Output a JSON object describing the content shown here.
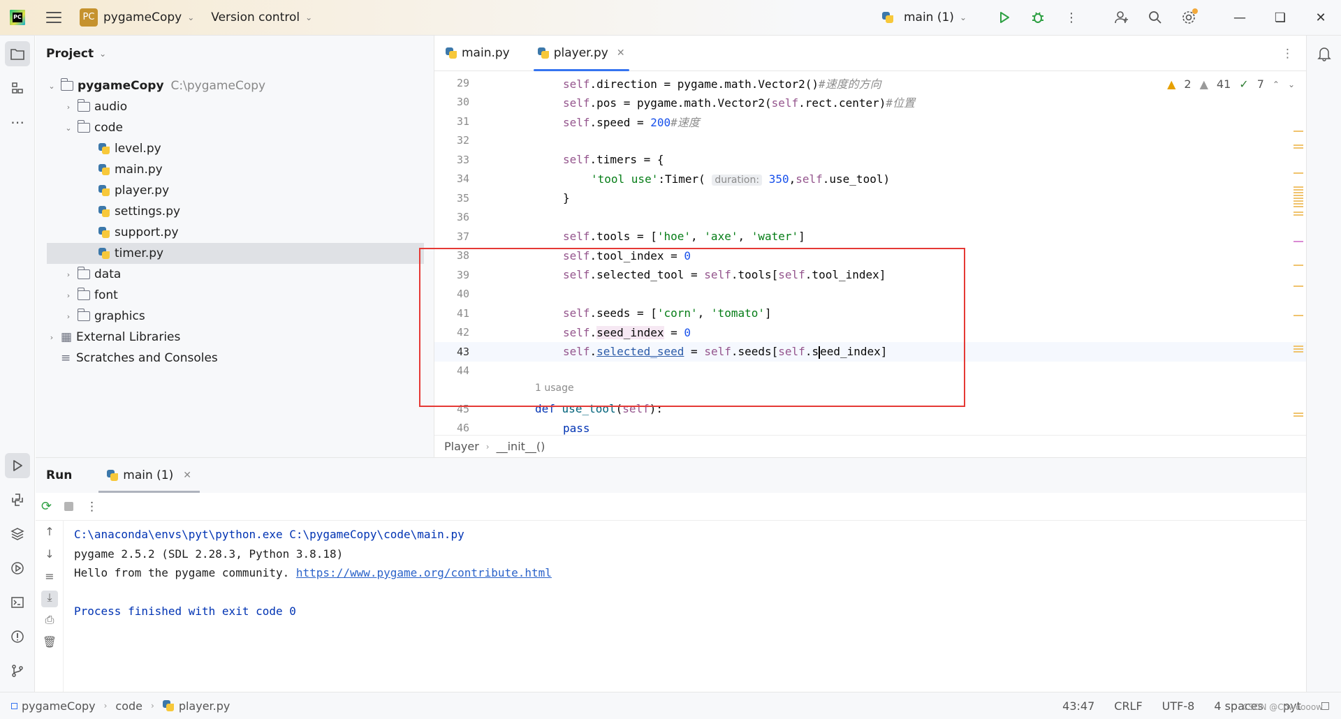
{
  "titlebar": {
    "project_badge": "PC",
    "project_name": "pygameCopy",
    "version_control": "Version control",
    "run_config": "main (1)"
  },
  "project_panel": {
    "title": "Project",
    "root_name": "pygameCopy",
    "root_path": "C:\\pygameCopy",
    "items": [
      {
        "label": "audio"
      },
      {
        "label": "code"
      },
      {
        "label": "level.py"
      },
      {
        "label": "main.py"
      },
      {
        "label": "player.py"
      },
      {
        "label": "settings.py"
      },
      {
        "label": "support.py"
      },
      {
        "label": "timer.py"
      },
      {
        "label": "data"
      },
      {
        "label": "font"
      },
      {
        "label": "graphics"
      },
      {
        "label": "External Libraries"
      },
      {
        "label": "Scratches and Consoles"
      }
    ]
  },
  "editor": {
    "tabs": [
      {
        "label": "main.py"
      },
      {
        "label": "player.py"
      }
    ],
    "inspections": {
      "warnings_a": "2",
      "warnings_b": "41",
      "ok": "7"
    },
    "line_numbers": [
      "29",
      "30",
      "31",
      "32",
      "33",
      "34",
      "35",
      "36",
      "37",
      "38",
      "39",
      "40",
      "41",
      "42",
      "43",
      "44",
      "45",
      "46"
    ],
    "code": {
      "l29": {
        "a": "self",
        "b": ".direction = pygame.math.Vector2()",
        "c": "#速度的方向"
      },
      "l30": {
        "a": "self",
        "b": ".pos = pygame.math.Vector2(",
        "c": "self",
        "d": ".rect.center)",
        "e": "#位置"
      },
      "l31": {
        "a": "self",
        "b": ".speed = ",
        "c": "200",
        "d": "#速度"
      },
      "l33": {
        "a": "self",
        "b": ".timers = {"
      },
      "l34": {
        "a": "'tool use'",
        "b": ":Timer(",
        "hint": "duration:",
        "c": "350",
        "d": ",",
        "e": "self",
        "f": ".use_tool)"
      },
      "l35": {
        "a": "}"
      },
      "l37": {
        "a": "self",
        "b": ".tools = [",
        "c": "'hoe'",
        "d": ", ",
        "e": "'axe'",
        "f": ", ",
        "g": "'water'",
        "h": "]"
      },
      "l38": {
        "a": "self",
        "b": ".tool_index = ",
        "c": "0"
      },
      "l39": {
        "a": "self",
        "b": ".selected_tool = ",
        "c": "self",
        "d": ".tools[",
        "e": "self",
        "f": ".tool_index]"
      },
      "l41": {
        "a": "self",
        "b": ".seeds = [",
        "c": "'corn'",
        "d": ", ",
        "e": "'tomato'",
        "f": "]"
      },
      "l42": {
        "a": "self",
        "b": ".",
        "c": "seed_index",
        "d": " = ",
        "e": "0"
      },
      "l43": {
        "a": "self",
        "b": ".",
        "c": "selected_seed",
        "d": " = ",
        "e": "self",
        "f": ".seeds[",
        "g": "self",
        "h": ".s",
        "i": "eed_index]"
      },
      "usage": "1 usage",
      "l45": {
        "a": "def",
        "b": " ",
        "c": "use_tool",
        "d": "(",
        "e": "self",
        "f": "):"
      },
      "l46": {
        "a": "pass"
      }
    },
    "breadcrumb": [
      "Player",
      "__init__()"
    ]
  },
  "run_panel": {
    "title": "Run",
    "tab_label": "main (1)",
    "console": [
      "C:\\anaconda\\envs\\pyt\\python.exe C:\\pygameCopy\\code\\main.py",
      "pygame 2.5.2 (SDL 2.28.3, Python 3.8.18)",
      "Hello from the pygame community. ",
      "https://www.pygame.org/contribute.html",
      "Process finished with exit code 0"
    ]
  },
  "statusbar": {
    "crumbs": [
      "pygameCopy",
      "code",
      "player.py"
    ],
    "position": "43:47",
    "line_sep": "CRLF",
    "encoding": "UTF-8",
    "indent": "4 spaces",
    "interpreter": "pyt",
    "watermark": "CSDN @Cowoooow"
  },
  "colors": {
    "accent": "#3574f0",
    "highlight_box": "#e53935",
    "run_green": "#2ea043",
    "warning": "#e6a000"
  }
}
